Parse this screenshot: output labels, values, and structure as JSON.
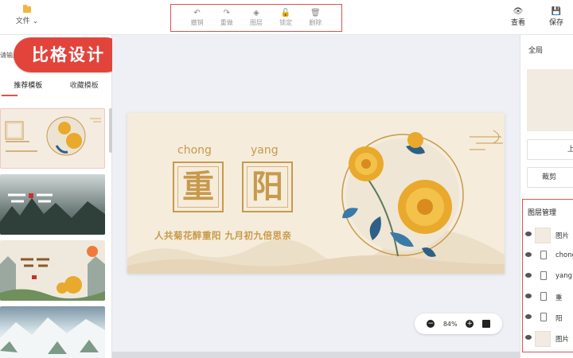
{
  "header": {
    "file_label": "文件 ⌄",
    "toolbar": [
      {
        "icon": "undo-icon",
        "glyph": "↶",
        "label": "撤销"
      },
      {
        "icon": "redo-icon",
        "glyph": "↷",
        "label": "重做"
      },
      {
        "icon": "layers-icon",
        "glyph": "◈",
        "label": "图层"
      },
      {
        "icon": "lock-icon",
        "glyph": "🔓",
        "label": "锁定"
      },
      {
        "icon": "trash-icon",
        "glyph": "🗑",
        "label": "删除"
      }
    ],
    "preview_label": "查看",
    "save_label": "保存"
  },
  "logo_text": "比格设计",
  "left_panel": {
    "sub_label": "请输入",
    "tab_recommended": "推荐模板",
    "tab_favorites": "收藏模板"
  },
  "design": {
    "pinyin_1": "chong",
    "pinyin_2": "yang",
    "char_1": "重",
    "char_2": "阳",
    "poem": "人共菊花醉重阳 九月初九倍思亲",
    "colors": {
      "background": "#f5ecdc",
      "accent": "#c79a4c",
      "flower": "#e9a92c",
      "leaf": "#2e5f86"
    }
  },
  "zoom": {
    "value": "84%"
  },
  "right_panel": {
    "global_label": "全局",
    "upload_label": "上",
    "crop_label": "裁剪",
    "layers_title": "图层管理",
    "layers": [
      "图片",
      "chong",
      "yang",
      "重",
      "阳",
      "图片"
    ]
  },
  "colors": {
    "highlight_border": "#e0524d",
    "logo_bg": "#e2443b"
  }
}
